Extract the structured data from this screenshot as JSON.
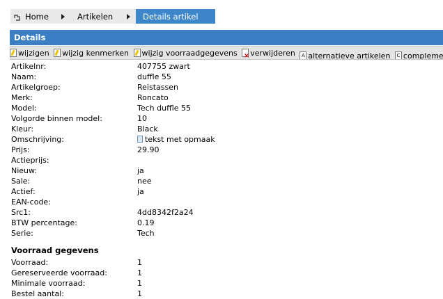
{
  "breadcrumb": {
    "home": "Home",
    "artikelen": "Artikelen",
    "current": "Details artikel"
  },
  "panel": {
    "title": "Details"
  },
  "toolbar": [
    {
      "label": "wijzigen",
      "icon": "pencil-icon"
    },
    {
      "label": "wijzig kenmerken",
      "icon": "pencil-icon"
    },
    {
      "label": "wijzig voorraadgegevens",
      "icon": "pencil-icon"
    },
    {
      "label": "verwijderen",
      "icon": "delete-icon"
    },
    {
      "label": "alternatieve artikelen",
      "icon": "doc-a-icon",
      "letter": "A"
    },
    {
      "label": "complementaire artikelen",
      "icon": "doc-c-icon",
      "letter": "C"
    }
  ],
  "details": [
    {
      "label": "Artikelnr:",
      "value": "407755 zwart"
    },
    {
      "label": "Naam:",
      "value": "duffle 55"
    },
    {
      "label": "Artikelgroep:",
      "value": "Reistassen"
    },
    {
      "label": "Merk:",
      "value": "Roncato"
    },
    {
      "label": "Model:",
      "value": "Tech duffle 55"
    },
    {
      "label": "Volgorde binnen model:",
      "value": "10"
    },
    {
      "label": "Kleur:",
      "value": "Black"
    },
    {
      "label": "Omschrijving:",
      "value": "tekst met opmaak"
    },
    {
      "label": "Prijs:",
      "value": "29.90"
    },
    {
      "label": "Actieprijs:",
      "value": ""
    },
    {
      "label": "Nieuw:",
      "value": "ja"
    },
    {
      "label": "Sale:",
      "value": "nee"
    },
    {
      "label": "Actief:",
      "value": "ja"
    },
    {
      "label": "EAN-code:",
      "value": ""
    },
    {
      "label": "Src1:",
      "value": "4dd8342f2a24"
    },
    {
      "label": "BTW percentage:",
      "value": "0.19"
    },
    {
      "label": "Serie:",
      "value": "Tech"
    }
  ],
  "stock": {
    "title": "Voorraad gegevens",
    "rows": [
      {
        "label": "Voorraad:",
        "value": "1"
      },
      {
        "label": "Gereserveerde voorraad:",
        "value": "1"
      },
      {
        "label": "Minimale voorraad:",
        "value": "1"
      },
      {
        "label": "Bestel aantal:",
        "value": "1"
      }
    ]
  },
  "colors": {
    "accent": "#3a7fc4",
    "toolbar_bg": "#e4e4e4",
    "crumb_bg": "#e9e9e9"
  }
}
